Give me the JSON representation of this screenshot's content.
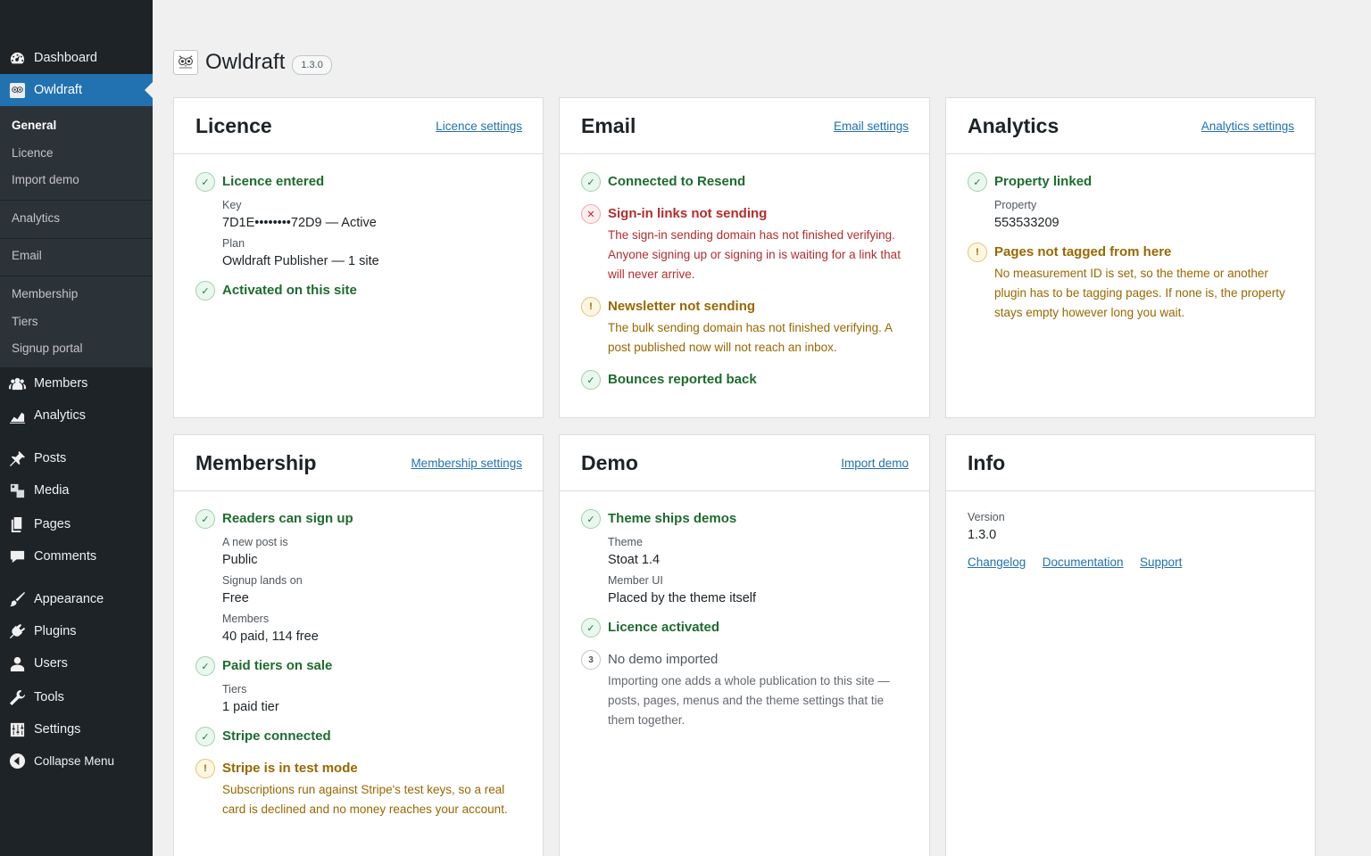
{
  "sidebar": {
    "items": [
      {
        "label": "Dashboard",
        "icon": "dashboard-icon"
      },
      {
        "label": "Owldraft",
        "icon": "owl-icon",
        "active": true
      },
      {
        "label": "Members",
        "icon": "members-icon"
      },
      {
        "label": "Analytics",
        "icon": "analytics-icon"
      },
      {
        "label": "Posts",
        "icon": "pin-icon"
      },
      {
        "label": "Media",
        "icon": "media-icon"
      },
      {
        "label": "Pages",
        "icon": "pages-icon"
      },
      {
        "label": "Comments",
        "icon": "comment-icon"
      },
      {
        "label": "Appearance",
        "icon": "brush-icon"
      },
      {
        "label": "Plugins",
        "icon": "plugin-icon"
      },
      {
        "label": "Users",
        "icon": "user-icon"
      },
      {
        "label": "Tools",
        "icon": "wrench-icon"
      },
      {
        "label": "Settings",
        "icon": "settings-icon"
      },
      {
        "label": "Collapse Menu",
        "icon": "collapse-icon"
      }
    ],
    "submenu": [
      "General",
      "Licence",
      "Import demo",
      "Analytics",
      "Email",
      "Membership",
      "Tiers",
      "Signup portal"
    ]
  },
  "header": {
    "title": "Owldraft",
    "version": "1.3.0"
  },
  "licence": {
    "title": "Licence",
    "link": "Licence settings",
    "entered": "Licence entered",
    "key_label": "Key",
    "key_value": "7D1E••••••••72D9 — Active",
    "plan_label": "Plan",
    "plan_value": "Owldraft Publisher — 1 site",
    "activated": "Activated on this site"
  },
  "email": {
    "title": "Email",
    "link": "Email settings",
    "connected": "Connected to Resend",
    "signin_title": "Sign-in links not sending",
    "signin_desc": "The sign-in sending domain has not finished verifying. Anyone signing up or signing in is waiting for a link that will never arrive.",
    "newsletter_title": "Newsletter not sending",
    "newsletter_desc": "The bulk sending domain has not finished verifying. A post published now will not reach an inbox.",
    "bounces": "Bounces reported back"
  },
  "analytics": {
    "title": "Analytics",
    "link": "Analytics settings",
    "linked": "Property linked",
    "property_label": "Property",
    "property_value": "553533209",
    "tagged_title": "Pages not tagged from here",
    "tagged_desc": "No measurement ID is set, so the theme or another plugin has to be tagging pages. If none is, the property stays empty however long you wait."
  },
  "membership": {
    "title": "Membership",
    "link": "Membership settings",
    "signup": "Readers can sign up",
    "newpost_label": "A new post is",
    "newpost_value": "Public",
    "lands_label": "Signup lands on",
    "lands_value": "Free",
    "members_label": "Members",
    "members_value": "40 paid, 114 free",
    "tiers_title": "Paid tiers on sale",
    "tiers_label": "Tiers",
    "tiers_value": "1 paid tier",
    "stripe": "Stripe connected",
    "testmode_title": "Stripe is in test mode",
    "testmode_desc": "Subscriptions run against Stripe's test keys, so a real card is declined and no money reaches your account."
  },
  "demo": {
    "title": "Demo",
    "link": "Import demo",
    "ships": "Theme ships demos",
    "theme_label": "Theme",
    "theme_value": "Stoat 1.4",
    "ui_label": "Member UI",
    "ui_value": "Placed by the theme itself",
    "licence": "Licence activated",
    "step_num": "3",
    "none_title": "No demo imported",
    "none_desc": "Importing one adds a whole publication to this site — posts, pages, menus and the theme settings that tie them together."
  },
  "info": {
    "title": "Info",
    "version_label": "Version",
    "version_value": "1.3.0",
    "links": [
      "Changelog",
      "Documentation",
      "Support"
    ]
  },
  "colors": {
    "accent": "#2271b1",
    "sidebar": "#1d2327",
    "ok": "#1e6b2f",
    "error": "#b32d2e",
    "warn": "#996800"
  }
}
